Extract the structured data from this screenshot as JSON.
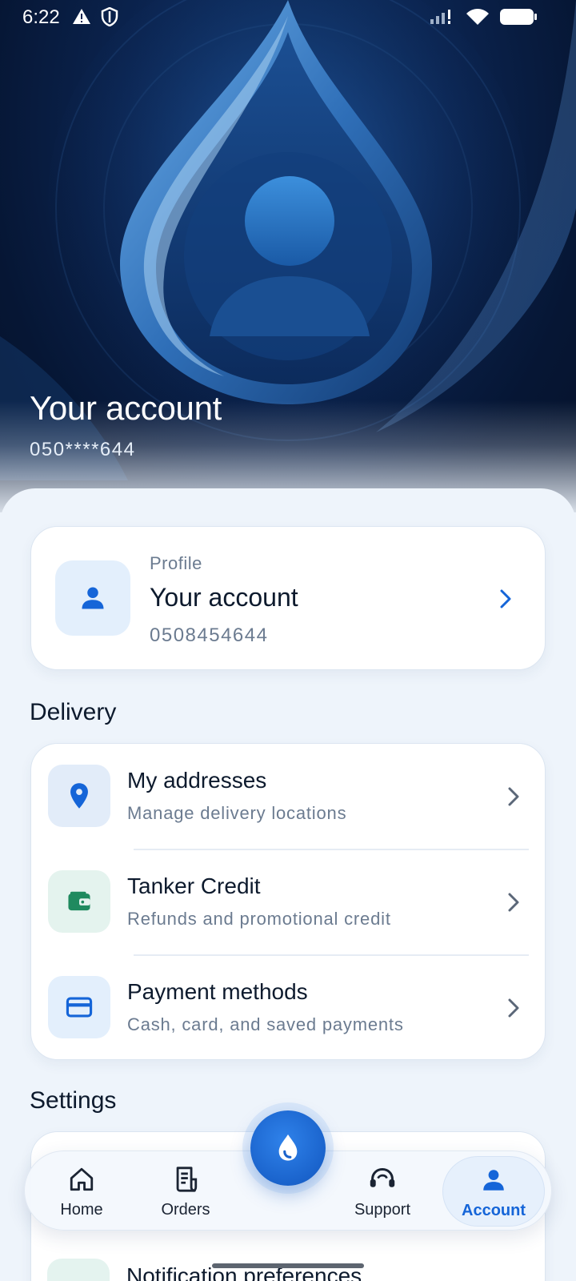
{
  "status_bar": {
    "time": "6:22",
    "icons": [
      "warning-icon",
      "shield-icon",
      "signal-icon",
      "wifi-icon",
      "battery-icon"
    ]
  },
  "header": {
    "title": "Your account",
    "phone_masked": "050****644"
  },
  "profile": {
    "overline": "Profile",
    "name": "Your account",
    "phone": "0508454644",
    "icon": "person-icon"
  },
  "delivery": {
    "section_title": "Delivery",
    "items": [
      {
        "title": "My addresses",
        "subtitle": "Manage delivery locations",
        "icon": "location-pin-icon"
      },
      {
        "title": "Tanker Credit",
        "subtitle": "Refunds and promotional credit",
        "icon": "wallet-icon"
      },
      {
        "title": "Payment methods",
        "subtitle": "Cash, card, and saved payments",
        "icon": "credit-card-icon"
      }
    ]
  },
  "settings": {
    "section_title": "Settings",
    "items": [
      {
        "title": "Notification preferences",
        "icon": "notification-icon"
      }
    ]
  },
  "bottom_nav": {
    "items": [
      {
        "label": "Home",
        "icon": "home-icon",
        "active": false
      },
      {
        "label": "Orders",
        "icon": "receipt-icon",
        "active": false
      },
      {
        "label": "Support",
        "icon": "headset-icon",
        "active": false
      },
      {
        "label": "Account",
        "icon": "person-icon",
        "active": true
      }
    ],
    "fab_icon": "water-drop-icon"
  },
  "colors": {
    "accent": "#1565d8",
    "hero_dark": "#061634",
    "background": "#eef4fb",
    "credit_green": "#1f8a5f"
  }
}
